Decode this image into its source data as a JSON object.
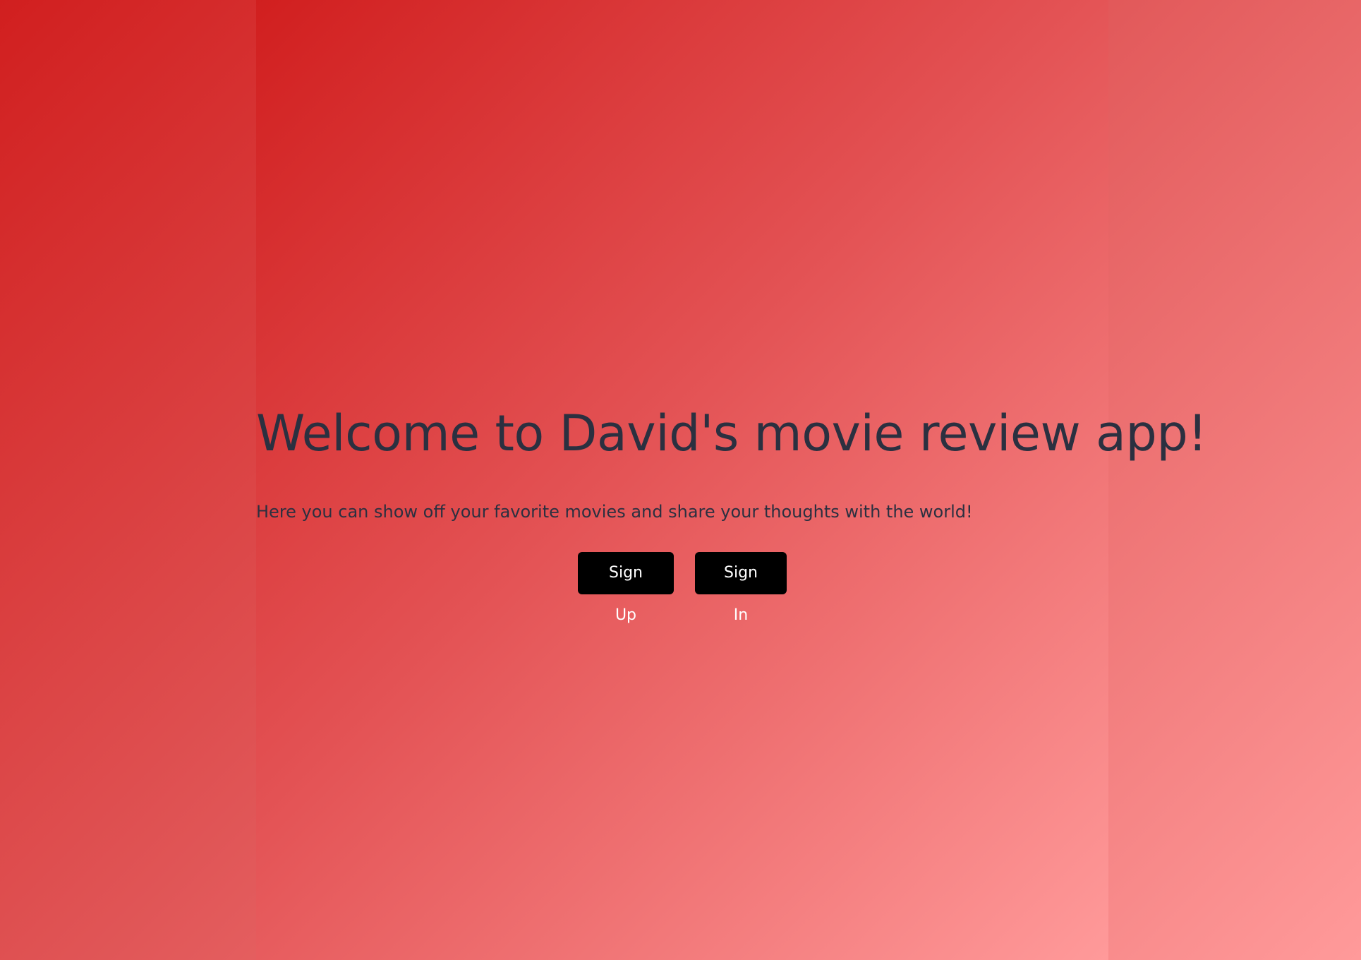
{
  "page": {
    "background_start": "#d11f1f",
    "background_end": "#ff9a9a"
  },
  "hero": {
    "title": "Welcome to David's movie review app!",
    "subtitle": "Here you can show off your favorite movies and share your thoughts with the world!"
  },
  "actions": {
    "sign_up_label": "Sign Up",
    "sign_in_label": "Sign In"
  },
  "colors": {
    "text": "#2b3040",
    "button_background": "#000000",
    "button_text": "#ffffff"
  }
}
